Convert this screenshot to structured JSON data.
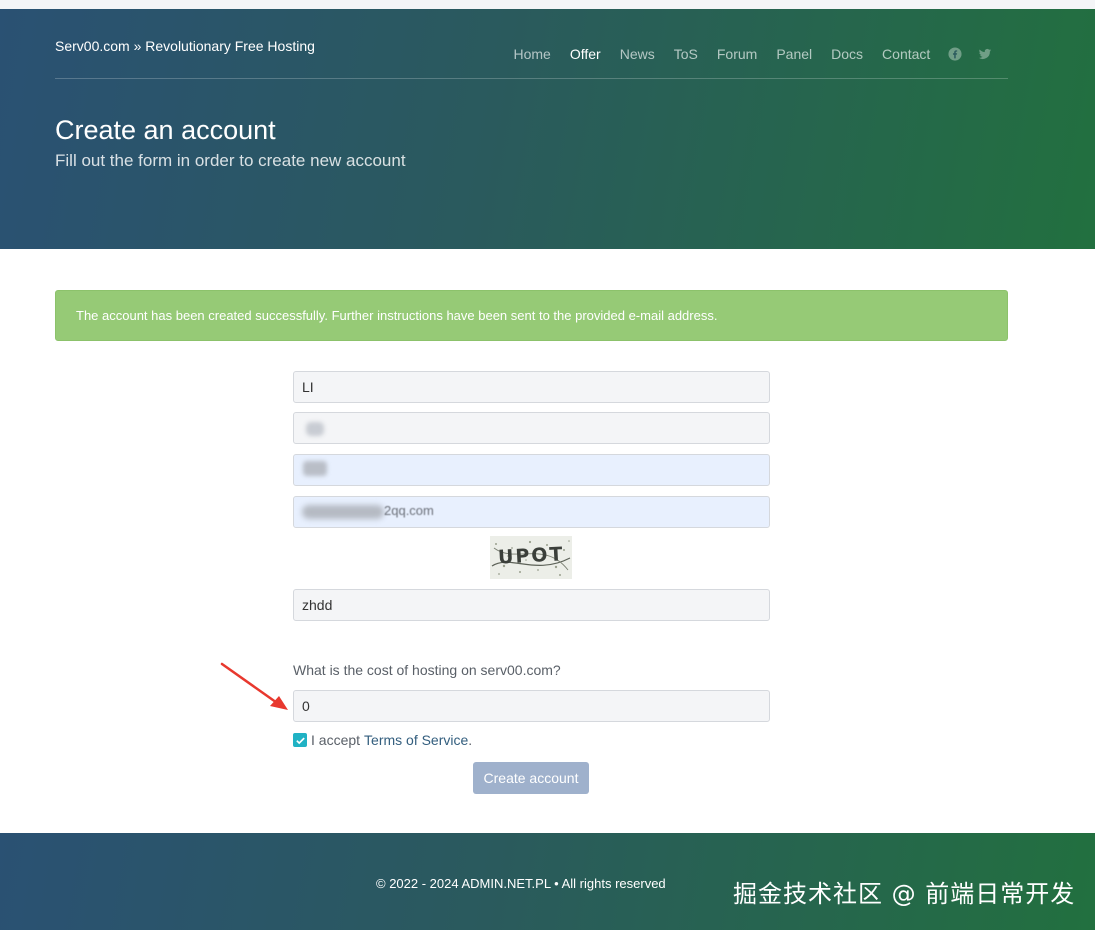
{
  "header": {
    "brand": "Serv00.com » Revolutionary Free Hosting",
    "nav": [
      {
        "label": "Home"
      },
      {
        "label": "Offer",
        "active": true
      },
      {
        "label": "News"
      },
      {
        "label": "ToS"
      },
      {
        "label": "Forum"
      },
      {
        "label": "Panel"
      },
      {
        "label": "Docs"
      },
      {
        "label": "Contact"
      }
    ],
    "social_icons": [
      "facebook-icon",
      "twitter-icon"
    ],
    "title": "Create an account",
    "subtitle": "Fill out the form in order to create new account"
  },
  "alert": {
    "message": "The account has been created successfully. Further instructions have been sent to the provided e-mail address.",
    "color": "#96ca76"
  },
  "form": {
    "first_name": "LI",
    "email_visible_tail": "2qq.com",
    "captcha_text": "UPOT",
    "captcha_answer": "zhdd",
    "question": "What is the cost of hosting on serv00.com?",
    "answer": "0",
    "tos_prefix": "I accept",
    "tos_link": "Terms of Service",
    "tos_suffix": ".",
    "tos_checked": true,
    "submit_label": "Create account"
  },
  "footer": {
    "copyright": "© 2022 - 2024 ADMIN.NET.PL • All rights reserved",
    "watermark": "掘金技术社区 @ 前端日常开发"
  },
  "colors": {
    "hero_start": "#2a5173",
    "hero_end": "#22703f",
    "checkbox": "#20b2c4",
    "button": "#9fb1cc",
    "link": "#335e7e"
  }
}
